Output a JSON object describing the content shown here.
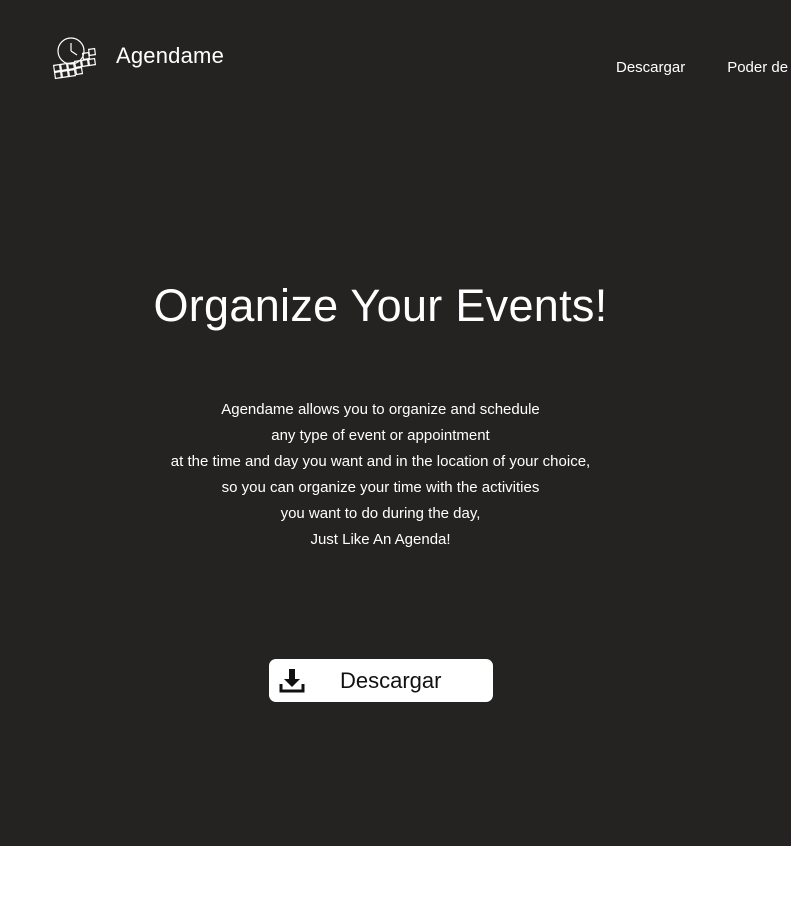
{
  "header": {
    "logo_text": "Agendame",
    "nav": [
      {
        "label": "Descargar"
      },
      {
        "label": "Poder de"
      }
    ]
  },
  "hero": {
    "headline": "Organize Your Events!",
    "description_lines": [
      "Agendame allows you to organize and schedule",
      "any type of event or appointment",
      "at the time and day you want and in the location of your choice,",
      "so you can organize your time with the activities",
      "you want to do during the day,",
      "Just Like An Agenda!"
    ],
    "download_button": {
      "label": "Descargar",
      "icon": "download-icon"
    }
  },
  "colors": {
    "hero_background": "#252222",
    "text": "#ffffff",
    "page_background": "#ffffff",
    "button_background": "#ffffff",
    "button_text": "#111111"
  }
}
